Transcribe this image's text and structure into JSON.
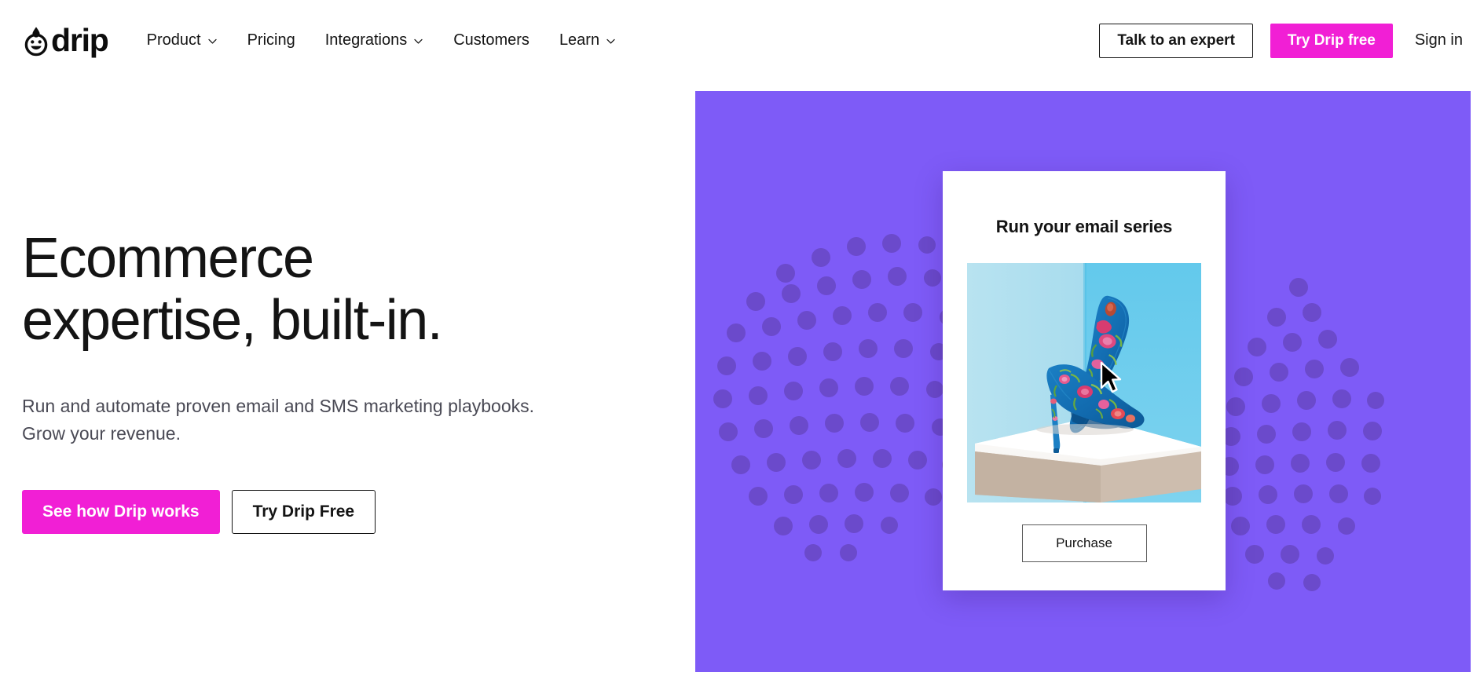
{
  "header": {
    "logo": {
      "wordmark": "drip",
      "mark_icon": "drip-smiley-face-icon"
    },
    "nav": [
      {
        "label": "Product",
        "has_dropdown": true,
        "icon": "chevron-down-icon"
      },
      {
        "label": "Pricing",
        "has_dropdown": false
      },
      {
        "label": "Integrations",
        "has_dropdown": true,
        "icon": "chevron-down-icon"
      },
      {
        "label": "Customers",
        "has_dropdown": false
      },
      {
        "label": "Learn",
        "has_dropdown": true,
        "icon": "chevron-down-icon"
      }
    ],
    "talk_to_expert_label": "Talk to an expert",
    "try_free_label": "Try Drip free",
    "sign_in_label": "Sign in"
  },
  "hero": {
    "headline_line1": "Ecommerce",
    "headline_line2": "expertise, built-in.",
    "subhead_line1": "Run and automate proven email and SMS marketing playbooks.",
    "subhead_line2": "Grow your revenue.",
    "primary_cta": "See how Drip works",
    "secondary_cta": "Try Drip Free"
  },
  "showcase": {
    "panel_color": "#7E5BF7",
    "dot_color": "#6B4ACB",
    "card": {
      "title": "Run your email series",
      "image_alt": "blue floral high heel pumps on white pedestal",
      "cursor_icon": "mouse-arrow-cursor-icon",
      "purchase_label": "Purchase"
    }
  },
  "theme": {
    "accent_magenta": "#F11FD5",
    "text_dark": "#141414",
    "text_muted": "#4a4a55",
    "purple": "#7E5BF7"
  }
}
